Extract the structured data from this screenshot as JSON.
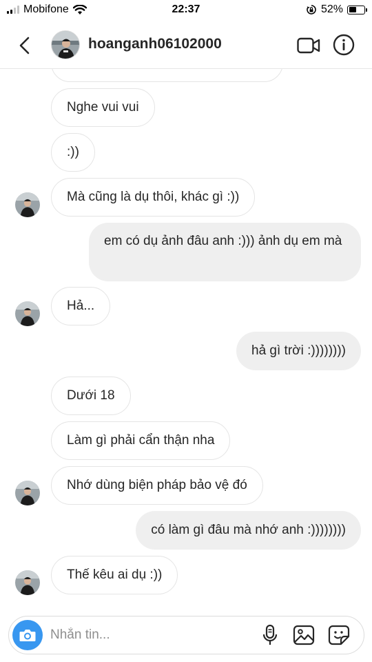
{
  "status_bar": {
    "carrier": "Mobifone",
    "time": "22:37",
    "battery_percent": "52%",
    "battery_level": 0.52,
    "signal_bars": 2,
    "icons": [
      "signal-icon",
      "wifi-icon",
      "rotation-lock-icon",
      "battery-icon"
    ]
  },
  "header": {
    "username": "hoanganh06102000",
    "icons": [
      "back-chevron-icon",
      "profile-avatar",
      "video-call-icon",
      "info-icon"
    ]
  },
  "messages": [
    {
      "side": "in",
      "text": "",
      "partial": true
    },
    {
      "side": "in",
      "text": "Nghe vui vui"
    },
    {
      "side": "in",
      "text": ":))"
    },
    {
      "side": "in",
      "text": "Mà cũng là dụ thôi, khác gì :))",
      "avatar": true
    },
    {
      "side": "out",
      "text": "em có dụ ảnh đâu anh :))) ảnh dụ em mà"
    },
    {
      "side": "in",
      "text": "Hả...",
      "avatar": true
    },
    {
      "side": "out",
      "text": "hả gì trời :))))))))"
    },
    {
      "side": "in",
      "text": "Dưới 18"
    },
    {
      "side": "in",
      "text": "Làm gì phải cẩn thận nha"
    },
    {
      "side": "in",
      "text": "Nhớ dùng biện pháp bảo vệ đó",
      "avatar": true
    },
    {
      "side": "out",
      "text": "có làm gì đâu mà nhớ anh :))))))))"
    },
    {
      "side": "in",
      "text": "Thế kêu ai dụ :))",
      "avatar": true
    }
  ],
  "composer": {
    "placeholder": "Nhắn tin...",
    "value": "",
    "icons": [
      "camera-icon",
      "microphone-icon",
      "gallery-icon",
      "sticker-icon"
    ]
  },
  "colors": {
    "accent_blue": "#3897f0",
    "outgoing_bubble": "#efefef",
    "incoming_border": "#e4e4e4",
    "text": "#262626",
    "placeholder": "#8e8e8e"
  }
}
